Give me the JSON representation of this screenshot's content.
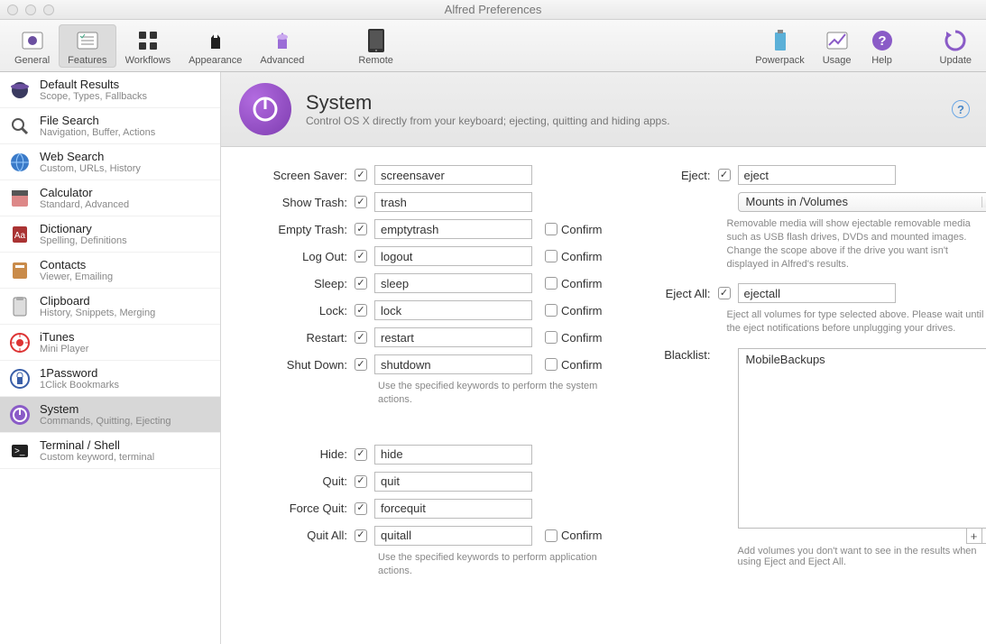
{
  "window": {
    "title": "Alfred Preferences"
  },
  "toolbar": {
    "items": [
      {
        "id": "general",
        "label": "General"
      },
      {
        "id": "features",
        "label": "Features"
      },
      {
        "id": "workflows",
        "label": "Workflows"
      },
      {
        "id": "appearance",
        "label": "Appearance"
      },
      {
        "id": "advanced",
        "label": "Advanced"
      },
      {
        "id": "remote",
        "label": "Remote"
      }
    ],
    "right": [
      {
        "id": "powerpack",
        "label": "Powerpack"
      },
      {
        "id": "usage",
        "label": "Usage"
      },
      {
        "id": "help",
        "label": "Help"
      },
      {
        "id": "update",
        "label": "Update"
      }
    ],
    "selected": "features"
  },
  "sidebar": {
    "items": [
      {
        "label": "Default Results",
        "sub": "Scope, Types, Fallbacks"
      },
      {
        "label": "File Search",
        "sub": "Navigation, Buffer, Actions"
      },
      {
        "label": "Web Search",
        "sub": "Custom, URLs, History"
      },
      {
        "label": "Calculator",
        "sub": "Standard, Advanced"
      },
      {
        "label": "Dictionary",
        "sub": "Spelling, Definitions"
      },
      {
        "label": "Contacts",
        "sub": "Viewer, Emailing"
      },
      {
        "label": "Clipboard",
        "sub": "History, Snippets, Merging"
      },
      {
        "label": "iTunes",
        "sub": "Mini Player"
      },
      {
        "label": "1Password",
        "sub": "1Click Bookmarks"
      },
      {
        "label": "System",
        "sub": "Commands, Quitting, Ejecting"
      },
      {
        "label": "Terminal / Shell",
        "sub": "Custom keyword, terminal"
      }
    ],
    "selected": 9
  },
  "pane": {
    "title": "System",
    "subtitle": "Control OS X directly from your keyboard; ejecting, quitting and hiding apps.",
    "left": [
      {
        "label": "Screen Saver:",
        "checked": true,
        "value": "screensaver",
        "confirm": null
      },
      {
        "label": "Show Trash:",
        "checked": true,
        "value": "trash",
        "confirm": null
      },
      {
        "label": "Empty Trash:",
        "checked": true,
        "value": "emptytrash",
        "confirm": false
      },
      {
        "label": "Log Out:",
        "checked": true,
        "value": "logout",
        "confirm": false
      },
      {
        "label": "Sleep:",
        "checked": true,
        "value": "sleep",
        "confirm": false
      },
      {
        "label": "Lock:",
        "checked": true,
        "value": "lock",
        "confirm": false
      },
      {
        "label": "Restart:",
        "checked": true,
        "value": "restart",
        "confirm": false
      },
      {
        "label": "Shut Down:",
        "checked": true,
        "value": "shutdown",
        "confirm": false
      }
    ],
    "hint1": "Use the specified keywords to perform the system actions.",
    "left2": [
      {
        "label": "Hide:",
        "checked": true,
        "value": "hide",
        "confirm": null
      },
      {
        "label": "Quit:",
        "checked": true,
        "value": "quit",
        "confirm": null
      },
      {
        "label": "Force Quit:",
        "checked": true,
        "value": "forcequit",
        "confirm": null
      },
      {
        "label": "Quit All:",
        "checked": true,
        "value": "quitall",
        "confirm": false
      }
    ],
    "hint2": "Use the specified keywords to perform application actions.",
    "confirm_label": "Confirm",
    "right": {
      "eject": {
        "label": "Eject:",
        "checked": true,
        "value": "eject"
      },
      "mounts_select": "Mounts in /Volumes",
      "mounts_hint": "Removable media will show ejectable removable media such as USB flash drives, DVDs and mounted images. Change the scope above if the drive you want isn't displayed in Alfred's results.",
      "eject_all": {
        "label": "Eject All:",
        "checked": true,
        "value": "ejectall"
      },
      "eject_all_hint": "Eject all volumes for type selected above. Please wait until the eject notifications before unplugging your drives.",
      "blacklist_label": "Blacklist:",
      "blacklist_items": [
        "MobileBackups"
      ],
      "blacklist_hint": "Add volumes you don't want to see in the results when using Eject and Eject All."
    }
  }
}
